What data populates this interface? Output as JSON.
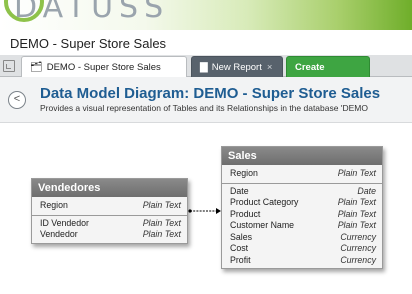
{
  "logo": {
    "text": "DATUSS"
  },
  "window": {
    "title": "DEMO - Super Store Sales"
  },
  "tabs": [
    {
      "label": "DEMO - Super Store Sales",
      "icon": "diagram-icon"
    },
    {
      "label": "New Report",
      "close": "×",
      "icon": "bar-chart-icon"
    },
    {
      "label": "Create New",
      "plus": "+"
    }
  ],
  "header": {
    "back_glyph": "<",
    "title": "Data Model Diagram: DEMO - Super Store Sales",
    "subtitle": "Provides a visual representation of Tables and its Relationships in the database 'DEMO"
  },
  "tables": {
    "vendedores": {
      "name": "Vendedores",
      "key_fields": [
        {
          "field": "Region",
          "type": "Plain Text"
        }
      ],
      "fields": [
        {
          "field": "ID Vendedor",
          "type": "Plain Text"
        },
        {
          "field": "Vendedor",
          "type": "Plain Text"
        }
      ]
    },
    "sales": {
      "name": "Sales",
      "key_fields": [
        {
          "field": "Region",
          "type": "Plain Text"
        }
      ],
      "fields": [
        {
          "field": "Date",
          "type": "Date"
        },
        {
          "field": "Product Category",
          "type": "Plain Text"
        },
        {
          "field": "Product",
          "type": "Plain Text"
        },
        {
          "field": "Customer Name",
          "type": "Plain Text"
        },
        {
          "field": "Sales",
          "type": "Currency"
        },
        {
          "field": "Cost",
          "type": "Currency"
        },
        {
          "field": "Profit",
          "type": "Currency"
        }
      ]
    }
  },
  "colors": {
    "title_blue": "#1f5d92",
    "create_green": "#3ea542",
    "new_report_gray": "#58626c",
    "table_header": "#7a7a7a"
  }
}
